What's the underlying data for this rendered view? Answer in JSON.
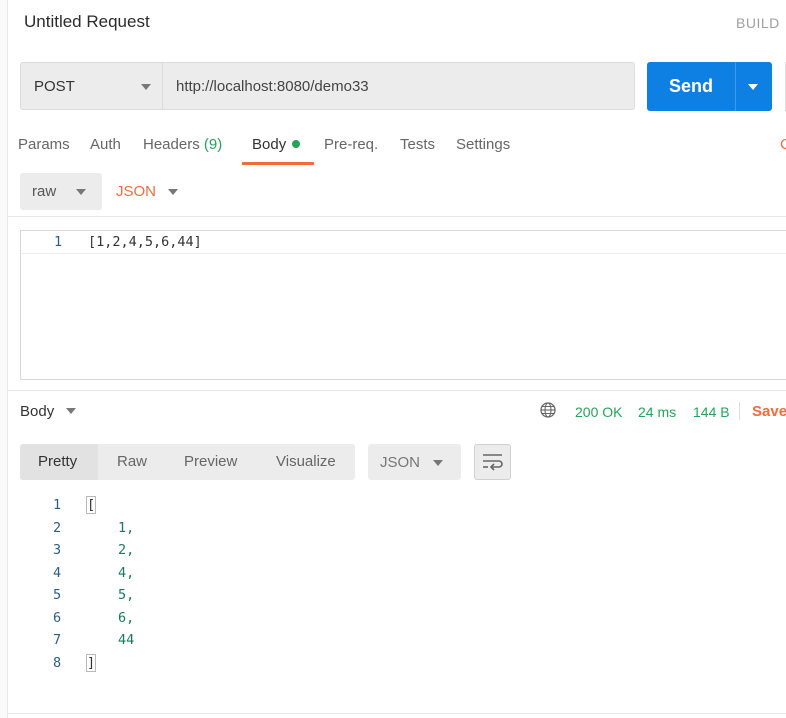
{
  "request": {
    "title": "Untitled Request",
    "build_label": "BUILD",
    "method": "POST",
    "url": "http://localhost:8080/demo33",
    "send_label": "Send"
  },
  "tabs": {
    "params": "Params",
    "auth": "Auth",
    "headers": "Headers",
    "headers_count": "(9)",
    "body": "Body",
    "prereq": "Pre-req.",
    "tests": "Tests",
    "settings": "Settings",
    "cookies_partial": "C"
  },
  "body_editor": {
    "mode": "raw",
    "language": "JSON",
    "line_number": "1",
    "content": "[1,2,4,5,6,44]"
  },
  "response": {
    "title": "Body",
    "status": "200 OK",
    "time": "24 ms",
    "size": "144 B",
    "save_label": "Save",
    "formats": [
      "Pretty",
      "Raw",
      "Preview",
      "Visualize"
    ],
    "language": "JSON",
    "lines": [
      {
        "n": "1",
        "text": "["
      },
      {
        "n": "2",
        "text": "1,"
      },
      {
        "n": "3",
        "text": "2,"
      },
      {
        "n": "4",
        "text": "4,"
      },
      {
        "n": "5",
        "text": "5,"
      },
      {
        "n": "6",
        "text": "6,"
      },
      {
        "n": "7",
        "text": "44"
      },
      {
        "n": "8",
        "text": "]"
      }
    ]
  },
  "colors": {
    "accent": "#f26b3a",
    "send": "#0f80e3",
    "success": "#25a35a"
  }
}
